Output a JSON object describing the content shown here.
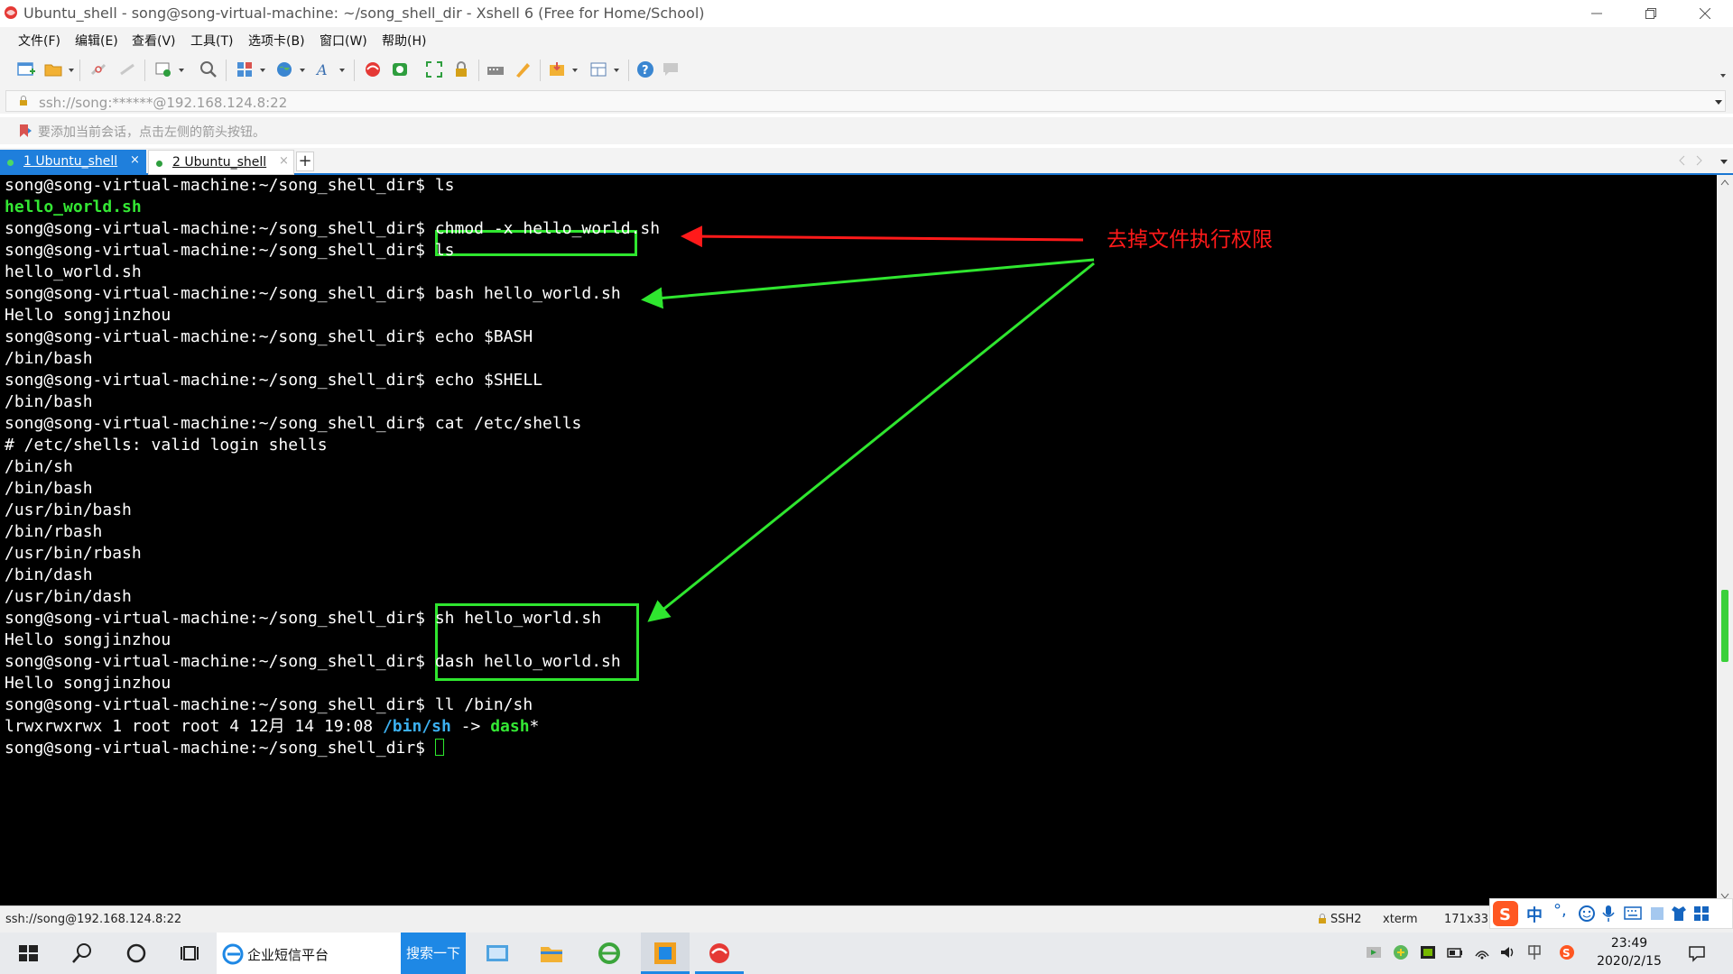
{
  "window": {
    "title": "Ubuntu_shell - song@song-virtual-machine: ~/song_shell_dir - Xshell 6 (Free for Home/School)"
  },
  "menu": {
    "items": [
      "文件(F)",
      "编辑(E)",
      "查看(V)",
      "工具(T)",
      "选项卡(B)",
      "窗口(W)",
      "帮助(H)"
    ]
  },
  "address": {
    "value": "ssh://song:******@192.168.124.8:22"
  },
  "hint": {
    "text": "要添加当前会话，点击左侧的箭头按钮。"
  },
  "tabs": [
    {
      "label": "1 Ubuntu_shell",
      "close": "×",
      "active": true
    },
    {
      "label": "2 Ubuntu_shell",
      "close": "×",
      "active": false
    }
  ],
  "terminal": {
    "lines": [
      {
        "prompt": "song@song-virtual-machine:~/song_shell_dir$ ",
        "cmd": "ls"
      },
      {
        "green": "hello_world.sh"
      },
      {
        "prompt": "song@song-virtual-machine:~/song_shell_dir$ ",
        "cmd": "chmod -x hello_world.sh"
      },
      {
        "prompt": "song@song-virtual-machine:~/song_shell_dir$ ",
        "cmd": "ls"
      },
      {
        "out": "hello_world.sh"
      },
      {
        "prompt": "song@song-virtual-machine:~/song_shell_dir$ ",
        "cmd": "bash hello_world.sh"
      },
      {
        "out": "Hello songjinzhou"
      },
      {
        "prompt": "song@song-virtual-machine:~/song_shell_dir$ ",
        "cmd": "echo $BASH"
      },
      {
        "out": "/bin/bash"
      },
      {
        "prompt": "song@song-virtual-machine:~/song_shell_dir$ ",
        "cmd": "echo $SHELL"
      },
      {
        "out": "/bin/bash"
      },
      {
        "prompt": "song@song-virtual-machine:~/song_shell_dir$ ",
        "cmd": "cat /etc/shells"
      },
      {
        "out": "# /etc/shells: valid login shells"
      },
      {
        "out": "/bin/sh"
      },
      {
        "out": "/bin/bash"
      },
      {
        "out": "/usr/bin/bash"
      },
      {
        "out": "/bin/rbash"
      },
      {
        "out": "/usr/bin/rbash"
      },
      {
        "out": "/bin/dash"
      },
      {
        "out": "/usr/bin/dash"
      },
      {
        "prompt": "song@song-virtual-machine:~/song_shell_dir$ ",
        "cmd": "sh hello_world.sh"
      },
      {
        "out": "Hello songjinzhou"
      },
      {
        "prompt": "song@song-virtual-machine:~/song_shell_dir$ ",
        "cmd": "dash hello_world.sh"
      },
      {
        "out": "Hello songjinzhou"
      },
      {
        "prompt": "song@song-virtual-machine:~/song_shell_dir$ ",
        "cmd": "ll /bin/sh"
      },
      {
        "ls_prefix": "lrwxrwxrwx 1 root root 4 12月 14 19:08 ",
        "ls_link": "/bin/sh",
        "ls_arrow": " -> ",
        "ls_target": "dash",
        "ls_suffix": "*"
      },
      {
        "prompt": "song@song-virtual-machine:~/song_shell_dir$ ",
        "cmd": "",
        "cursor": true
      }
    ]
  },
  "annotation": {
    "text": "去掉文件执行权限",
    "color": "#ff1a1a",
    "box_color": "#2fe62f"
  },
  "statusbar": {
    "connection": "ssh://song@192.168.124.8:22",
    "protocol": "SSH2",
    "terminal_type": "xterm",
    "size": "171x33"
  },
  "taskbar": {
    "app_label": "企业短信平台",
    "search_button": "搜索一下",
    "time": "23:49",
    "date": "2020/2/15"
  },
  "ime": {
    "mode": "中"
  }
}
